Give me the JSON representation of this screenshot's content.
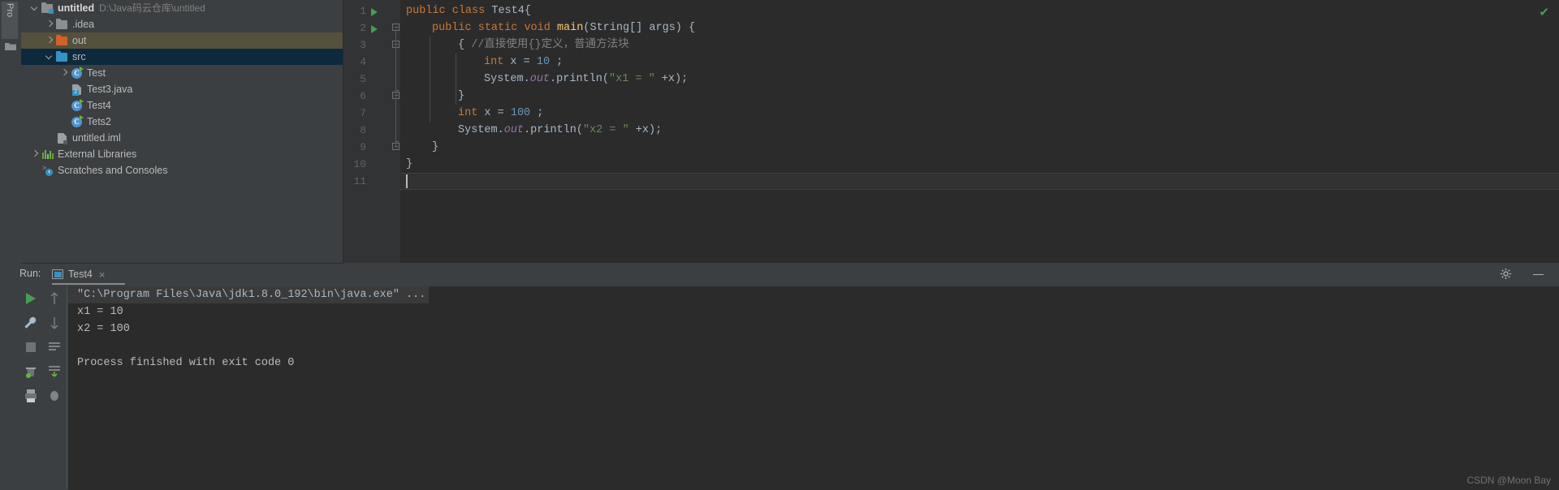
{
  "rail": {
    "tab_label": "Pro",
    "folder_icon": "folder-icon"
  },
  "project_tree": [
    {
      "label": "untitled",
      "path": "D:\\Java码云仓库\\untitled",
      "icon": "module-folder-icon",
      "arrow": "down",
      "depth": 0,
      "bold": true,
      "state": "normal"
    },
    {
      "label": ".idea",
      "path": "",
      "icon": "folder-grey-icon",
      "arrow": "right",
      "depth": 1,
      "bold": false,
      "state": "normal"
    },
    {
      "label": "out",
      "path": "",
      "icon": "folder-orange-icon",
      "arrow": "right",
      "depth": 1,
      "bold": false,
      "state": "out"
    },
    {
      "label": "src",
      "path": "",
      "icon": "folder-blue-icon",
      "arrow": "down",
      "depth": 1,
      "bold": false,
      "state": "src"
    },
    {
      "label": "Test",
      "path": "",
      "icon": "java-class-icon",
      "arrow": "right",
      "depth": 2,
      "bold": false,
      "state": "normal"
    },
    {
      "label": "Test3.java",
      "path": "",
      "icon": "java-file-icon",
      "arrow": "none",
      "depth": 2,
      "bold": false,
      "state": "normal"
    },
    {
      "label": "Test4",
      "path": "",
      "icon": "java-class-icon",
      "arrow": "none",
      "depth": 2,
      "bold": false,
      "state": "normal"
    },
    {
      "label": "Tets2",
      "path": "",
      "icon": "java-class-icon",
      "arrow": "none",
      "depth": 2,
      "bold": false,
      "state": "normal"
    },
    {
      "label": "untitled.iml",
      "path": "",
      "icon": "iml-file-icon",
      "arrow": "none",
      "depth": 1,
      "bold": false,
      "state": "normal"
    },
    {
      "label": "External Libraries",
      "path": "",
      "icon": "libraries-icon",
      "arrow": "right",
      "depth": 0,
      "bold": false,
      "state": "normal"
    },
    {
      "label": "Scratches and Consoles",
      "path": "",
      "icon": "scratches-icon",
      "arrow": "none",
      "depth": 0,
      "bold": false,
      "state": "normal"
    }
  ],
  "editor": {
    "inspection_status_icon": "checkmark-icon",
    "lines": [
      {
        "n": "1",
        "run": true,
        "fold": "none",
        "indent": 0,
        "text": "public class Test4{"
      },
      {
        "n": "2",
        "run": true,
        "fold": "open",
        "indent": 1,
        "text": "public static void main(String[] args) {"
      },
      {
        "n": "3",
        "run": false,
        "fold": "open",
        "indent": 2,
        "text": "{ //直接使用{}定义，普通方法块"
      },
      {
        "n": "4",
        "run": false,
        "fold": "none",
        "indent": 3,
        "text": "int x = 10 ;"
      },
      {
        "n": "5",
        "run": false,
        "fold": "none",
        "indent": 3,
        "text": "System.out.println(\"x1 = \" +x);"
      },
      {
        "n": "6",
        "run": false,
        "fold": "cap",
        "indent": 2,
        "text": "}"
      },
      {
        "n": "7",
        "run": false,
        "fold": "none",
        "indent": 2,
        "text": "int x = 100 ;"
      },
      {
        "n": "8",
        "run": false,
        "fold": "none",
        "indent": 2,
        "text": "System.out.println(\"x2 = \" +x);"
      },
      {
        "n": "9",
        "run": false,
        "fold": "cap",
        "indent": 1,
        "text": "}"
      },
      {
        "n": "10",
        "run": false,
        "fold": "none",
        "indent": 0,
        "text": "}"
      },
      {
        "n": "11",
        "run": false,
        "fold": "none",
        "indent": 0,
        "text": ""
      }
    ]
  },
  "run_panel": {
    "label": "Run:",
    "tab_name": "Test4",
    "tab_close_glyph": "×",
    "settings_icon": "gear-icon",
    "minimize_icon": "minimize-icon",
    "toolbar_left": [
      {
        "icon": "rerun-play-icon"
      },
      {
        "icon": "wrench-icon"
      },
      {
        "icon": "stop-square-icon"
      },
      {
        "icon": "trash-icon"
      },
      {
        "icon": "print-icon"
      }
    ],
    "toolbar_right": [
      {
        "icon": "arrow-up-icon"
      },
      {
        "icon": "arrow-down-icon"
      },
      {
        "icon": "soft-wrap-icon"
      },
      {
        "icon": "scroll-to-end-icon"
      }
    ],
    "console_lines": [
      {
        "text": "\"C:\\Program Files\\Java\\jdk1.8.0_192\\bin\\java.exe\" ...",
        "style": "cmd"
      },
      {
        "text": "x1 = 10",
        "style": "out"
      },
      {
        "text": "x2 = 100",
        "style": "out"
      },
      {
        "text": "",
        "style": "out"
      },
      {
        "text": "Process finished with exit code 0",
        "style": "out"
      }
    ]
  },
  "watermark": "CSDN @Moon Bay",
  "colors": {
    "panel_bg": "#3c3f41",
    "editor_bg": "#2b2b2b",
    "gutter_bg": "#313335",
    "selection_blue": "#0d293e",
    "selection_olive": "#55503c",
    "accent": "#3592c4",
    "keyword": "#cc7832",
    "number": "#6897bb",
    "string": "#6a8759",
    "comment": "#808080",
    "field": "#9876aa",
    "text": "#a9b7c6",
    "run_green": "#499c54"
  }
}
